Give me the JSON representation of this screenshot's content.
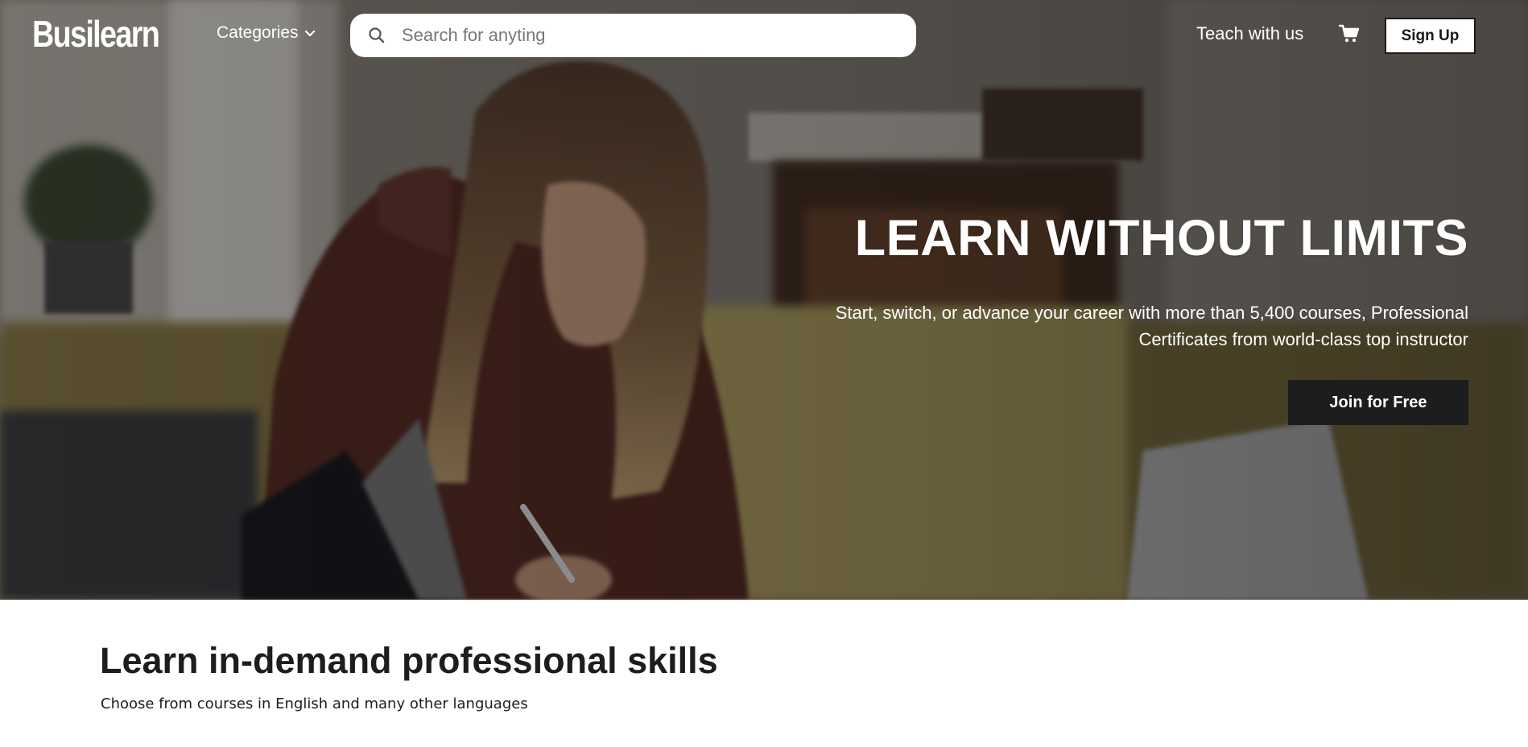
{
  "nav": {
    "logo": "Busilearn",
    "categories_label": "Categories",
    "search_placeholder": "Search for anyting",
    "teach_label": "Teach with us",
    "cart_icon": "shopping-cart-icon",
    "signup_label": "Sign Up"
  },
  "hero": {
    "title": "LEARN WITHOUT LIMITS",
    "subtitle": "Start, switch, or advance your career with more than 5,400 courses, Professional Certificates from world-class top instructor",
    "cta_label": "Join for Free",
    "image_description_icon": "hero-photo"
  },
  "section": {
    "title": "Learn in-demand professional skills",
    "subtitle": "Choose from courses in English and many other languages"
  },
  "colors": {
    "dark": "#1c1d1f",
    "white": "#ffffff",
    "hero_overlay": "#000000"
  }
}
